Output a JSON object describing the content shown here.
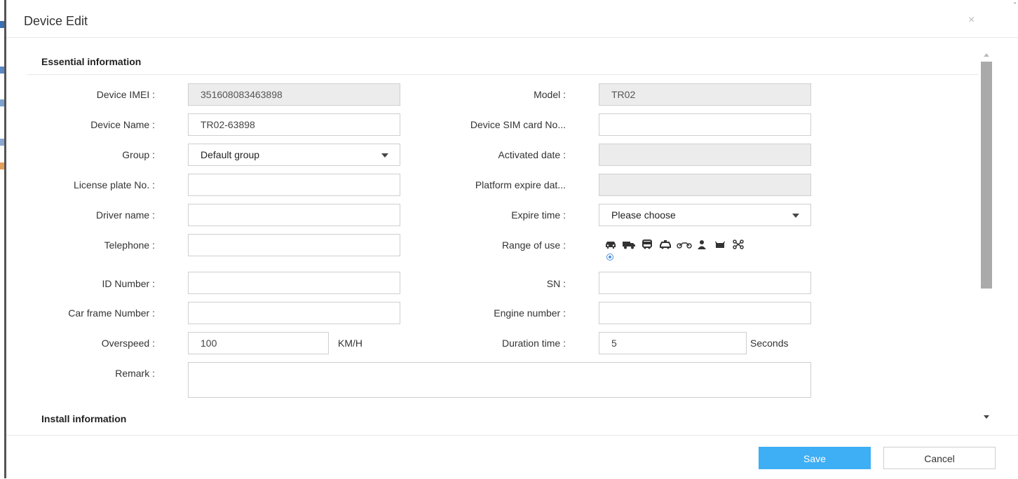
{
  "dialog": {
    "title": "Device Edit",
    "close_glyph": "×"
  },
  "sections": {
    "essential": "Essential information",
    "install": "Install information"
  },
  "fields": {
    "imei": {
      "label": "Device IMEI :",
      "value": "351608083463898"
    },
    "model": {
      "label": "Model :",
      "value": "TR02"
    },
    "device_name": {
      "label": "Device Name :",
      "value": "TR02-63898"
    },
    "sim_card": {
      "label": "Device SIM card No...",
      "value": ""
    },
    "group": {
      "label": "Group :",
      "value": "Default group"
    },
    "activated_date": {
      "label": "Activated date :",
      "value": ""
    },
    "license_plate": {
      "label": "License plate No. :",
      "value": ""
    },
    "platform_expire": {
      "label": "Platform expire dat...",
      "value": ""
    },
    "driver_name": {
      "label": "Driver name :",
      "value": ""
    },
    "expire_time": {
      "label": "Expire time :",
      "value": "Please choose"
    },
    "telephone": {
      "label": "Telephone :",
      "value": ""
    },
    "range_of_use": {
      "label": "Range of use :"
    },
    "id_number": {
      "label": "ID Number :",
      "value": ""
    },
    "sn": {
      "label": "SN :",
      "value": ""
    },
    "car_frame": {
      "label": "Car frame Number :",
      "value": ""
    },
    "engine_number": {
      "label": "Engine number :",
      "value": ""
    },
    "overspeed": {
      "label": "Overspeed :",
      "value": "100",
      "unit": "KM/H"
    },
    "duration_time": {
      "label": "Duration time :",
      "value": "5",
      "unit": "Seconds"
    },
    "remark": {
      "label": "Remark :",
      "value": ""
    }
  },
  "range_icons": [
    "car-icon",
    "truck-icon",
    "bus-icon",
    "taxi-icon",
    "motorcycle-icon",
    "person-icon",
    "cow-icon",
    "other-icon"
  ],
  "range_selected": "other",
  "buttons": {
    "save": "Save",
    "cancel": "Cancel"
  },
  "colors": {
    "primary": "#3eaef5",
    "disabled_bg": "#ececec",
    "grammarly": "#15c39a"
  }
}
